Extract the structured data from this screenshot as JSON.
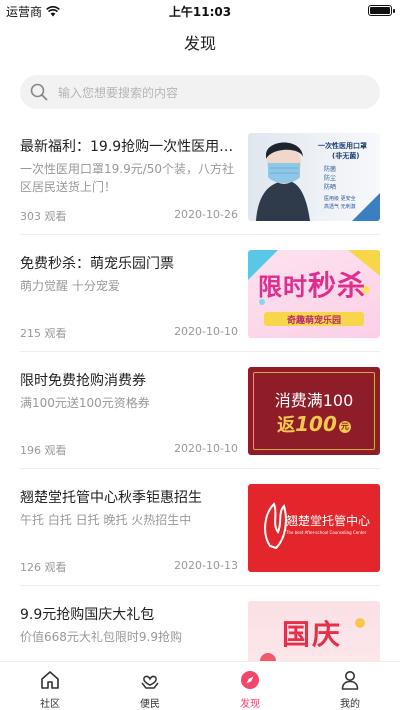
{
  "status_bar": {
    "carrier": "运营商",
    "time": "上午11:03"
  },
  "header": {
    "title": "发现"
  },
  "search": {
    "placeholder": "输入您想要搜索的内容"
  },
  "feed": [
    {
      "title": "最新福利：19.9抢购一次性医用口罩",
      "desc": "一次性医用口罩19.9元/50个装，八方社区居民送货上门！",
      "views": "303 观看",
      "date": "2020-10-26",
      "thumb": {
        "heading": "一次性医用口罩",
        "sub": "(非无菌)",
        "features": [
          "防菌",
          "防尘",
          "防晒"
        ],
        "notes": [
          "医用级  更安全",
          "高透气  无刺激"
        ]
      }
    },
    {
      "title": "免费秒杀：萌宠乐园门票",
      "desc": "萌力觉醒 十分宠爱",
      "views": "215 观看",
      "date": "2020-10-10",
      "thumb": {
        "heading_a": "限时",
        "heading_b": "秒杀",
        "ribbon": "奇趣萌宠乐园"
      }
    },
    {
      "title": "限时免费抢购消费券",
      "desc": "满100元送100元资格券",
      "views": "196 观看",
      "date": "2020-10-10",
      "thumb": {
        "line1": "消费满100",
        "line2_prefix": "返",
        "line2_value": "100",
        "line2_unit": "元"
      }
    },
    {
      "title": "翘楚堂托管中心秋季钜惠招生",
      "desc": "午托 白托 日托 晚托 火热招生中",
      "views": "126 观看",
      "date": "2020-10-13",
      "thumb": {
        "name": "翘楚堂托管中心",
        "english": "The best After-school Counseling Center"
      }
    },
    {
      "title": "9.9元抢购国庆大礼包",
      "desc": "价值668元大礼包限时9.9抢购",
      "thumb": {
        "text": "国庆"
      }
    }
  ],
  "tabbar": {
    "items": [
      {
        "label": "社区",
        "icon": "home-icon"
      },
      {
        "label": "便民",
        "icon": "heart-hand-icon"
      },
      {
        "label": "发现",
        "icon": "compass-icon"
      },
      {
        "label": "我的",
        "icon": "user-icon"
      }
    ],
    "active_color": "#f2476b",
    "inactive_color": "#333333"
  }
}
